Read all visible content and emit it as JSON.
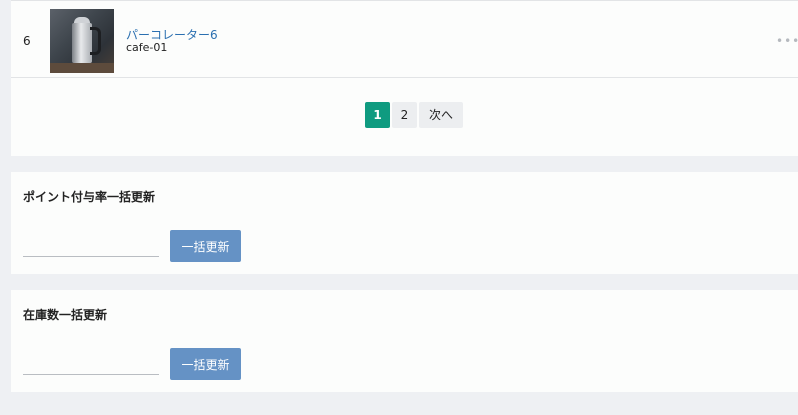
{
  "product_row": {
    "number": "6",
    "name": "パーコレーター6",
    "code": "cafe-01",
    "more_label": "•••"
  },
  "pagination": {
    "pages": [
      "1",
      "2"
    ],
    "active_page": "1",
    "next_label": "次へ"
  },
  "points_section": {
    "title": "ポイント付与率一括更新",
    "input_value": "",
    "button_label": "一括更新"
  },
  "stock_section": {
    "title": "在庫数一括更新",
    "input_value": "",
    "button_label": "一括更新"
  },
  "colors": {
    "accent": "#0f9b80",
    "button": "#6592c5",
    "link": "#2a6fb0",
    "background": "#eef0f3"
  }
}
